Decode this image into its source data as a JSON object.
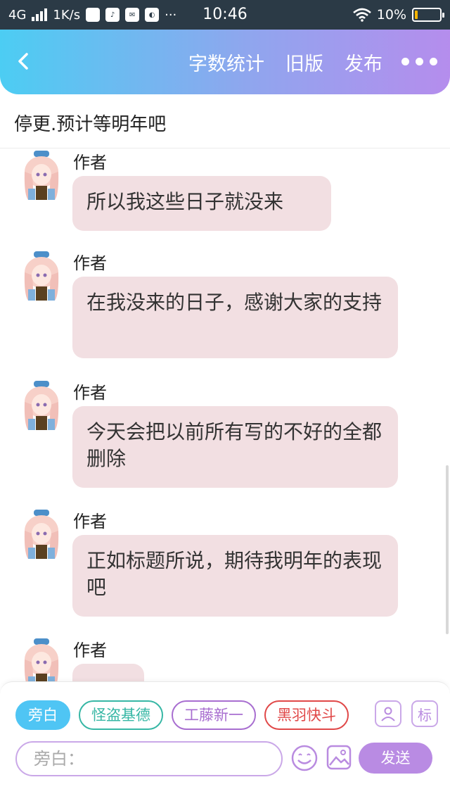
{
  "status_bar": {
    "network": "4G",
    "speed": "1K/s",
    "time": "10:46",
    "dots": "···",
    "battery": "10%",
    "app_weibo": "sina"
  },
  "header": {
    "links": [
      "字数统计",
      "旧版",
      "发布"
    ]
  },
  "title": "停更.预计等明年吧",
  "messages": [
    {
      "name": "作者",
      "text": "所以我这些日子就没来"
    },
    {
      "name": "作者",
      "text": "在我没来的日子，感谢大家的支持"
    },
    {
      "name": "作者",
      "text": "今天会把以前所有写的不好的全都删除"
    },
    {
      "name": "作者",
      "text": "正如标题所说，期待我明年的表现吧"
    },
    {
      "name": "作者",
      "text": ""
    }
  ],
  "composer": {
    "chips": [
      {
        "label": "旁白",
        "color": "#4fc5f4"
      },
      {
        "label": "怪盗基德",
        "color": "#37b7a5"
      },
      {
        "label": "工藤新一",
        "color": "#a86ed0"
      },
      {
        "label": "黑羽快斗",
        "color": "#e04848"
      }
    ],
    "tag_label": "标",
    "input_placeholder": "旁白：",
    "send_label": "发送"
  },
  "colors": {
    "bubble": "#f2dfe2",
    "header_start": "#4ccdf3",
    "header_end": "#b58ded",
    "send": "#b98be3"
  }
}
